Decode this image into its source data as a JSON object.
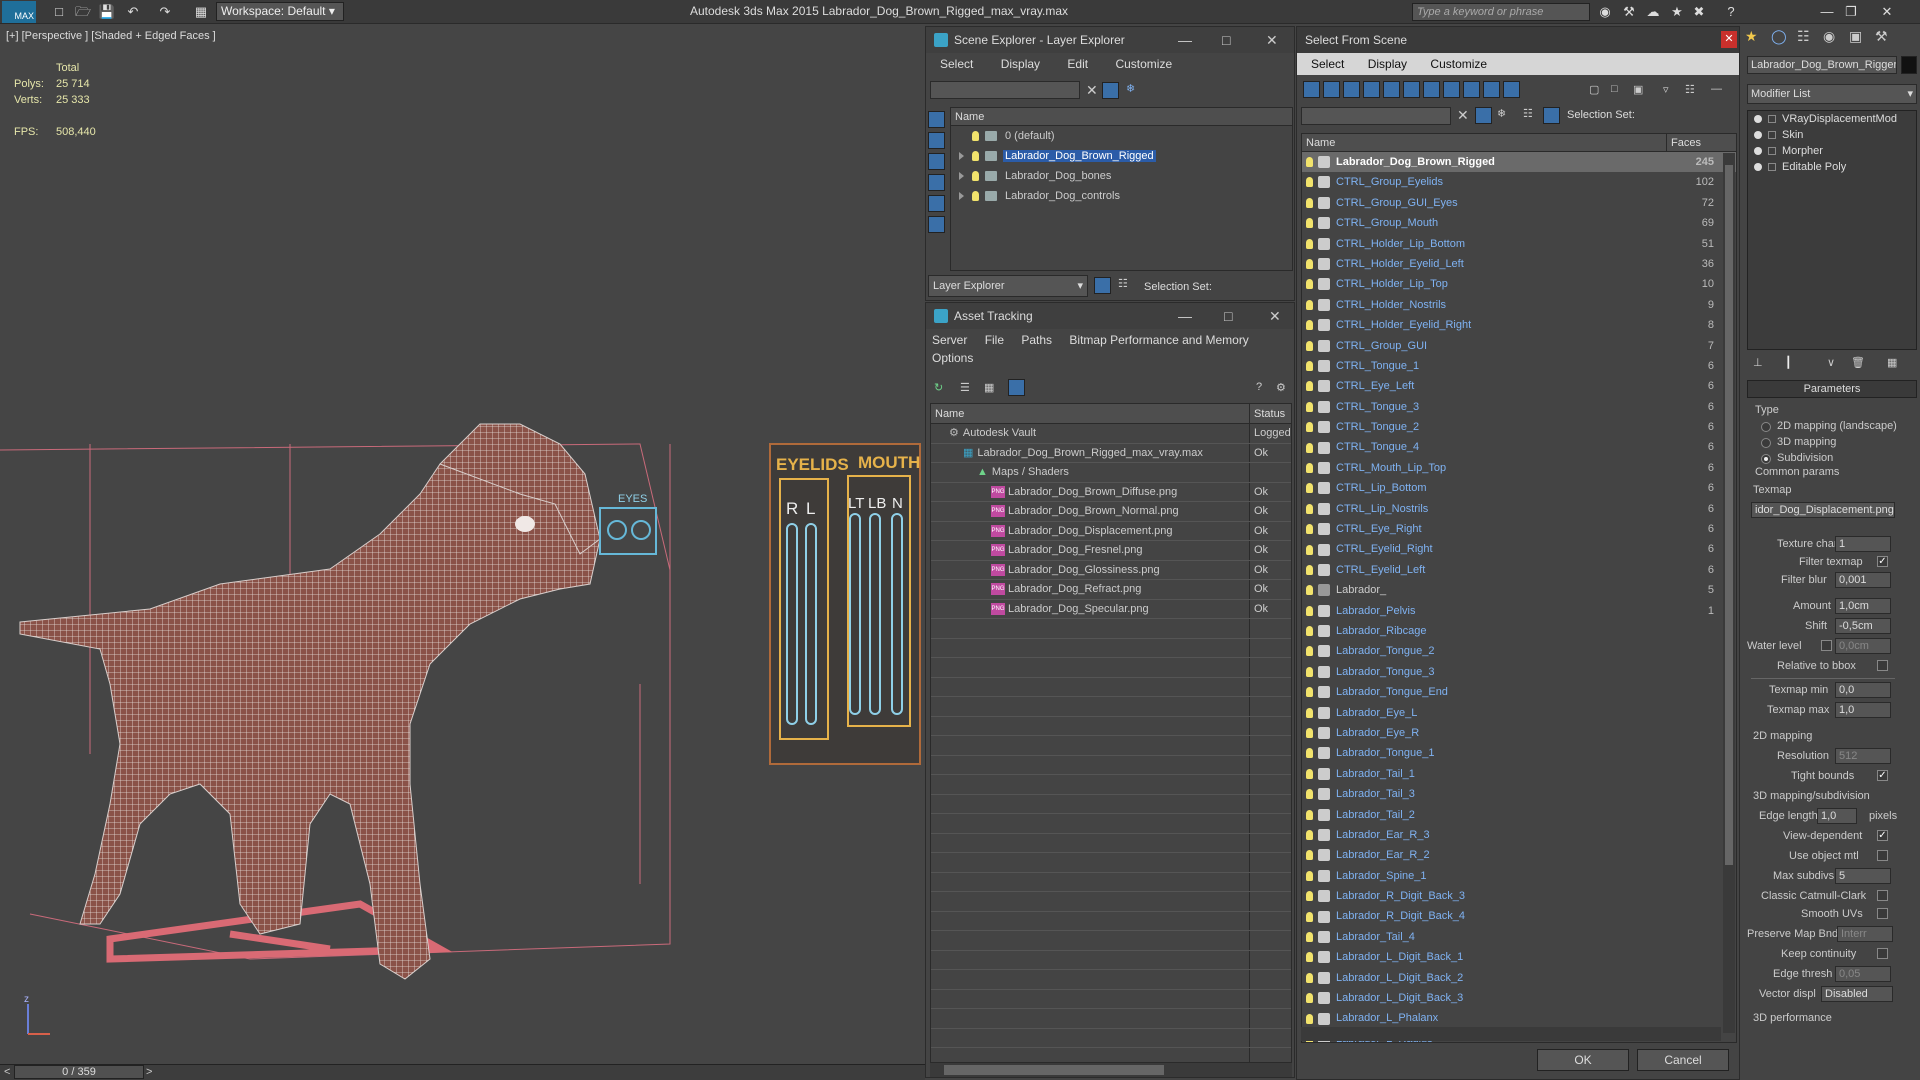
{
  "app": {
    "title": "Autodesk 3ds Max  2015    Labrador_Dog_Brown_Rigged_max_vray.max",
    "logo": "MAX",
    "workspace": "Workspace: Default",
    "search_placeholder": "Type a keyword or phrase"
  },
  "viewport": {
    "label": "[+] [Perspective ] [Shaded + Edged Faces ]",
    "stats_header": "Total",
    "polys_label": "Polys:",
    "polys_value": "25 714",
    "verts_label": "Verts:",
    "verts_value": "25 333",
    "fps_label": "FPS:",
    "fps_value": "508,440",
    "overlay_eyelids": "EYELIDS",
    "overlay_mouth": "MOUTH",
    "overlay_eyes": "EYES",
    "overlay_r": "R",
    "overlay_l": "L",
    "overlay_lt": "LT",
    "overlay_lb": "LB",
    "overlay_n": "N",
    "axis_z": "z"
  },
  "timeline": {
    "frame": "0 / 359"
  },
  "scene_explorer": {
    "title": "Scene Explorer - Layer Explorer",
    "menu": [
      "Select",
      "Display",
      "Edit",
      "Customize"
    ],
    "column": "Name",
    "layers": [
      {
        "name": "0 (default)",
        "expand": false,
        "selected": false
      },
      {
        "name": "Labrador_Dog_Brown_Rigged",
        "expand": true,
        "selected": true
      },
      {
        "name": "Labrador_Dog_bones",
        "expand": true,
        "selected": false
      },
      {
        "name": "Labrador_Dog_controls",
        "expand": true,
        "selected": false
      }
    ],
    "footer_dropdown": "Layer Explorer",
    "footer_selset": "Selection Set:"
  },
  "asset_tracking": {
    "title": "Asset Tracking",
    "menu": [
      "Server",
      "File",
      "Paths",
      "Bitmap Performance and Memory"
    ],
    "menu2": "Options",
    "col_name": "Name",
    "col_status": "Status",
    "rows": [
      {
        "name": "Autodesk Vault",
        "status": "Logged",
        "indent": 1,
        "icon": "vault"
      },
      {
        "name": "Labrador_Dog_Brown_Rigged_max_vray.max",
        "status": "Ok",
        "indent": 2,
        "icon": "max"
      },
      {
        "name": "Maps / Shaders",
        "status": "",
        "indent": 3,
        "icon": "maps"
      },
      {
        "name": "Labrador_Dog_Brown_Diffuse.png",
        "status": "Ok",
        "indent": 4,
        "icon": "png"
      },
      {
        "name": "Labrador_Dog_Brown_Normal.png",
        "status": "Ok",
        "indent": 4,
        "icon": "png"
      },
      {
        "name": "Labrador_Dog_Displacement.png",
        "status": "Ok",
        "indent": 4,
        "icon": "png"
      },
      {
        "name": "Labrador_Dog_Fresnel.png",
        "status": "Ok",
        "indent": 4,
        "icon": "png"
      },
      {
        "name": "Labrador_Dog_Glossiness.png",
        "status": "Ok",
        "indent": 4,
        "icon": "png"
      },
      {
        "name": "Labrador_Dog_Refract.png",
        "status": "Ok",
        "indent": 4,
        "icon": "png"
      },
      {
        "name": "Labrador_Dog_Specular.png",
        "status": "Ok",
        "indent": 4,
        "icon": "png"
      }
    ]
  },
  "select_from_scene": {
    "title": "Select From Scene",
    "menu": [
      "Select",
      "Display",
      "Customize"
    ],
    "selset": "Selection Set:",
    "col_name": "Name",
    "col_faces": "Faces",
    "rows": [
      {
        "name": "Labrador_Dog_Brown_Rigged",
        "faces": "245",
        "style": "sel"
      },
      {
        "name": "CTRL_Group_Eyelids",
        "faces": "102",
        "style": "blue"
      },
      {
        "name": "CTRL_Group_GUI_Eyes",
        "faces": "72",
        "style": "blue"
      },
      {
        "name": "CTRL_Group_Mouth",
        "faces": "69",
        "style": "blue"
      },
      {
        "name": "CTRL_Holder_Lip_Bottom",
        "faces": "51",
        "style": "blue"
      },
      {
        "name": "CTRL_Holder_Eyelid_Left",
        "faces": "36",
        "style": "blue"
      },
      {
        "name": "CTRL_Holder_Lip_Top",
        "faces": "10",
        "style": "blue"
      },
      {
        "name": "CTRL_Holder_Nostrils",
        "faces": "9",
        "style": "blue"
      },
      {
        "name": "CTRL_Holder_Eyelid_Right",
        "faces": "8",
        "style": "blue"
      },
      {
        "name": "CTRL_Group_GUI",
        "faces": "7",
        "style": "blue"
      },
      {
        "name": "CTRL_Tongue_1",
        "faces": "6",
        "style": "blue"
      },
      {
        "name": "CTRL_Eye_Left",
        "faces": "6",
        "style": "blue"
      },
      {
        "name": "CTRL_Tongue_3",
        "faces": "6",
        "style": "blue"
      },
      {
        "name": "CTRL_Tongue_2",
        "faces": "6",
        "style": "blue"
      },
      {
        "name": "CTRL_Tongue_4",
        "faces": "6",
        "style": "blue"
      },
      {
        "name": "CTRL_Mouth_Lip_Top",
        "faces": "6",
        "style": "blue"
      },
      {
        "name": "CTRL_Lip_Bottom",
        "faces": "6",
        "style": "blue"
      },
      {
        "name": "CTRL_Lip_Nostrils",
        "faces": "6",
        "style": "blue"
      },
      {
        "name": "CTRL_Eye_Right",
        "faces": "6",
        "style": "blue"
      },
      {
        "name": "CTRL_Eyelid_Right",
        "faces": "6",
        "style": "blue"
      },
      {
        "name": "CTRL_Eyelid_Left",
        "faces": "6",
        "style": "blue"
      },
      {
        "name": "Labrador_",
        "faces": "5",
        "style": "grey"
      },
      {
        "name": "Labrador_Pelvis",
        "faces": "1",
        "style": "blue"
      },
      {
        "name": "Labrador_Ribcage",
        "faces": "",
        "style": "blue"
      },
      {
        "name": "Labrador_Tongue_2",
        "faces": "",
        "style": "blue"
      },
      {
        "name": "Labrador_Tongue_3",
        "faces": "",
        "style": "blue"
      },
      {
        "name": "Labrador_Tongue_End",
        "faces": "",
        "style": "blue"
      },
      {
        "name": "Labrador_Eye_L",
        "faces": "",
        "style": "blue"
      },
      {
        "name": "Labrador_Eye_R",
        "faces": "",
        "style": "blue"
      },
      {
        "name": "Labrador_Tongue_1",
        "faces": "",
        "style": "blue"
      },
      {
        "name": "Labrador_Tail_1",
        "faces": "",
        "style": "blue"
      },
      {
        "name": "Labrador_Tail_3",
        "faces": "",
        "style": "blue"
      },
      {
        "name": "Labrador_Tail_2",
        "faces": "",
        "style": "blue"
      },
      {
        "name": "Labrador_Ear_R_3",
        "faces": "",
        "style": "blue"
      },
      {
        "name": "Labrador_Ear_R_2",
        "faces": "",
        "style": "blue"
      },
      {
        "name": "Labrador_Spine_1",
        "faces": "",
        "style": "blue"
      },
      {
        "name": "Labrador_R_Digit_Back_3",
        "faces": "",
        "style": "blue"
      },
      {
        "name": "Labrador_R_Digit_Back_4",
        "faces": "",
        "style": "blue"
      },
      {
        "name": "Labrador_Tail_4",
        "faces": "",
        "style": "blue"
      },
      {
        "name": "Labrador_L_Digit_Back_1",
        "faces": "",
        "style": "blue"
      },
      {
        "name": "Labrador_L_Digit_Back_2",
        "faces": "",
        "style": "blue"
      },
      {
        "name": "Labrador_L_Digit_Back_3",
        "faces": "",
        "style": "blue"
      },
      {
        "name": "Labrador_L_Phalanx",
        "faces": "",
        "style": "blue"
      },
      {
        "name": "Labrador_L_Radius",
        "faces": "",
        "style": "blue"
      }
    ],
    "ok": "OK",
    "cancel": "Cancel"
  },
  "command_panel": {
    "object_name": "Labrador_Dog_Brown_Rigger",
    "modifier_list": "Modifier List",
    "stack": [
      "VRayDisplacementMod",
      "Skin",
      "Morpher",
      "Editable Poly"
    ],
    "rollout": "Parameters",
    "type_label": "Type",
    "type_options": [
      "2D mapping (landscape)",
      "3D mapping",
      "Subdivision"
    ],
    "type_selected": 2,
    "common_params": "Common params",
    "texmap_label": "Texmap",
    "texmap_value": "idor_Dog_Displacement.png)",
    "texture_chan_label": "Texture chan",
    "texture_chan_value": "1",
    "filter_texmap_label": "Filter texmap",
    "filter_blur_label": "Filter blur",
    "filter_blur_value": "0,001",
    "amount_label": "Amount",
    "amount_value": "1,0cm",
    "shift_label": "Shift",
    "shift_value": "-0,5cm",
    "water_level_label": "Water level",
    "water_level_value": "0,0cm",
    "relative_bbox_label": "Relative to bbox",
    "texmap_min_label": "Texmap min",
    "texmap_min_value": "0,0",
    "texmap_max_label": "Texmap max",
    "texmap_max_value": "1,0",
    "mapping2d": "2D mapping",
    "resolution_label": "Resolution",
    "resolution_value": "512",
    "tight_bounds_label": "Tight bounds",
    "mapping3d": "3D mapping/subdivision",
    "edge_length_label": "Edge length",
    "edge_length_value": "1,0",
    "pixels_label": "pixels",
    "view_dependent_label": "View-dependent",
    "use_object_mtl_label": "Use object mtl",
    "max_subdivs_label": "Max subdivs",
    "max_subdivs_value": "5",
    "classic_cc_label": "Classic Catmull-Clark",
    "smooth_uvs_label": "Smooth UVs",
    "preserve_map_label": "Preserve Map Bnd",
    "preserve_map_value": "Interr",
    "keep_continuity_label": "Keep continuity",
    "edge_thresh_label": "Edge thresh",
    "edge_thresh_value": "0,05",
    "vector_displ_label": "Vector displ",
    "vector_displ_value": "Disabled",
    "perf3d": "3D performance"
  }
}
